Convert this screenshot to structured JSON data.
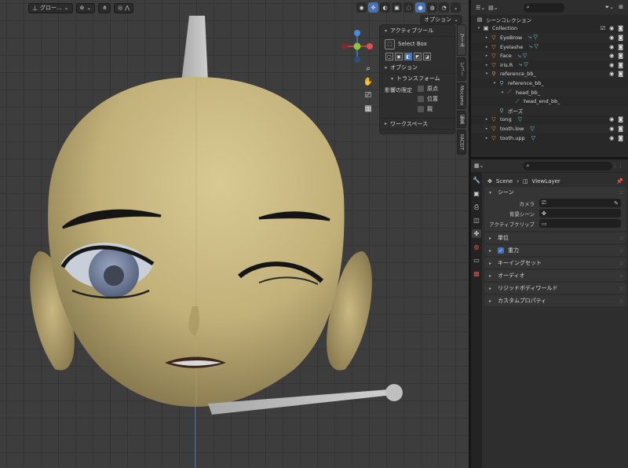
{
  "viewport": {
    "transform_orientation": "グロー...",
    "options_label": "オプション"
  },
  "npanel": {
    "active_tool_header": "アクティブツール",
    "tool_name": "Select Box",
    "options_header": "オプション",
    "transform_header": "トランスフォーム",
    "affect_only_label": "影響の限定",
    "affect_origins": "原点",
    "affect_locations": "位置",
    "affect_parents": "親",
    "workspace_header": "ワークスペース"
  },
  "side_tabs": [
    "ツール",
    "ビュー",
    "Mocamo",
    "編集",
    "FACEIT"
  ],
  "outliner": {
    "scene_collection": "シーンコレクション",
    "rows": [
      {
        "name": "Collection",
        "indent": 0,
        "icon": "▣",
        "cls": "",
        "alt": false,
        "extra": "",
        "vis": true,
        "twisty": "▾"
      },
      {
        "name": "EyeBrow",
        "indent": 1,
        "icon": "▽",
        "cls": "orange",
        "alt": true,
        "extra": "⤷ ▽",
        "vis": true,
        "twisty": "▸"
      },
      {
        "name": "Eyelashe",
        "indent": 1,
        "icon": "▽",
        "cls": "orange",
        "alt": false,
        "extra": "⤷ ▽",
        "vis": true,
        "twisty": "▸"
      },
      {
        "name": "Face",
        "indent": 1,
        "icon": "▽",
        "cls": "orange",
        "alt": true,
        "extra": "⤷ ▽",
        "vis": true,
        "twisty": "▸"
      },
      {
        "name": "iris.R",
        "indent": 1,
        "icon": "▽",
        "cls": "orange",
        "alt": false,
        "extra": "⤷ ▽",
        "vis": true,
        "twisty": "▸"
      },
      {
        "name": "reference_bb_",
        "indent": 1,
        "icon": "⚲",
        "cls": "orange",
        "alt": true,
        "extra": "",
        "vis": true,
        "twisty": "▾"
      },
      {
        "name": "reference_bb_",
        "indent": 2,
        "icon": "⚲",
        "cls": "green",
        "alt": false,
        "extra": "",
        "vis": false,
        "twisty": "▾"
      },
      {
        "name": "head_bb_",
        "indent": 3,
        "icon": "⟋",
        "cls": "green",
        "alt": true,
        "extra": "",
        "vis": false,
        "twisty": "▾"
      },
      {
        "name": "head_end_bb_",
        "indent": 4,
        "icon": "⟋",
        "cls": "green",
        "alt": false,
        "extra": "",
        "vis": false,
        "twisty": ""
      },
      {
        "name": "ポーズ",
        "indent": 2,
        "icon": "⚲",
        "cls": "green",
        "alt": true,
        "extra": "",
        "vis": false,
        "twisty": ""
      },
      {
        "name": "tong",
        "indent": 1,
        "icon": "▽",
        "cls": "orange",
        "alt": false,
        "extra": "▽",
        "vis": true,
        "twisty": "▸"
      },
      {
        "name": "tooth.low",
        "indent": 1,
        "icon": "▽",
        "cls": "orange",
        "alt": true,
        "extra": "▽",
        "vis": true,
        "twisty": "▸"
      },
      {
        "name": "tooth.upp",
        "indent": 1,
        "icon": "▽",
        "cls": "orange",
        "alt": false,
        "extra": "▽",
        "vis": true,
        "twisty": "▸"
      }
    ]
  },
  "properties": {
    "crumb_scene": "Scene",
    "crumb_layer": "ViewLayer",
    "scene_panel": "シーン",
    "camera_label": "カメラ",
    "background_scene_label": "背景シーン",
    "active_clip_label": "アクティブクリップ",
    "panels": [
      "単位",
      "重力",
      "キーイングセット",
      "オーディオ",
      "リジッドボディワールド",
      "カスタムプロパティ"
    ]
  }
}
